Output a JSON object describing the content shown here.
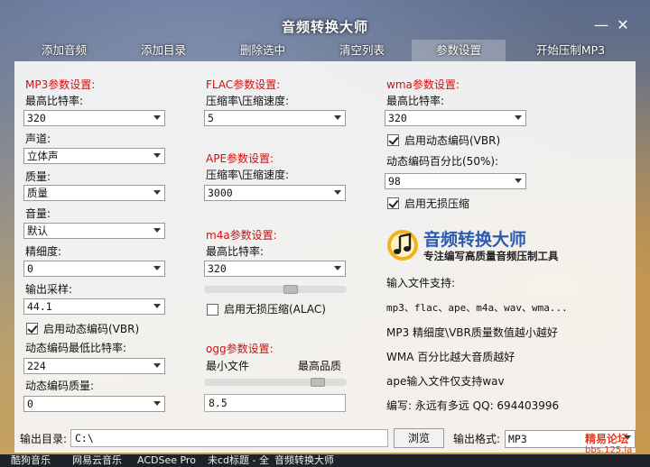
{
  "window": {
    "title": "音频转换大师"
  },
  "toolbar": {
    "add_audio": "添加音频",
    "add_folder": "添加目录",
    "delete_selected": "删除选中",
    "clear_list": "清空列表",
    "settings": "参数设置",
    "start": "开始压制MP3"
  },
  "mp3": {
    "header": "MP3参数设置:",
    "max_bitrate_label": "最高比特率:",
    "max_bitrate": "320",
    "channel_label": "声道:",
    "channel": "立体声",
    "quality_label": "质量:",
    "quality": "质量",
    "volume_label": "音量:",
    "volume": "默认",
    "precision_label": "精细度:",
    "precision": "0",
    "sample_label": "输出采样:",
    "sample": "44.1",
    "vbr_label": "启用动态编码(VBR)",
    "vbr_min_label": "动态编码最低比特率:",
    "vbr_min": "224",
    "vbr_quality_label": "动态编码质量:",
    "vbr_quality": "0"
  },
  "flac": {
    "header": "FLAC参数设置:",
    "rate_label": "压缩率\\压缩速度:",
    "rate": "5"
  },
  "ape": {
    "header": "APE参数设置:",
    "rate_label": "压缩率\\压缩速度:",
    "rate": "3000"
  },
  "m4a": {
    "header": "m4a参数设置:",
    "max_bitrate_label": "最高比特率:",
    "max_bitrate": "320",
    "lossless_label": "启用无损压缩(ALAC)"
  },
  "ogg": {
    "header": "ogg参数设置:",
    "min_label": "最小文件",
    "max_label": "最高品质",
    "value": "8.5"
  },
  "wma": {
    "header": "wma参数设置:",
    "max_bitrate_label": "最高比特率:",
    "max_bitrate": "320",
    "vbr_label": "启用动态编码(VBR)",
    "vbr_pct_label": "动态编码百分比(50%):",
    "vbr_pct": "98",
    "lossless_label": "启用无损压缩"
  },
  "info": {
    "brand_name": "音频转换大师",
    "brand_sub": "专注编写高质量音频压制工具",
    "input_title": "输入文件支持:",
    "formats": "mp3、flac、ape、m4a、wav、wma...",
    "line1": "MP3 精细度\\VBR质量数值越小越好",
    "line2": "WMA 百分比越大音质越好",
    "line3": "ape输入文件仅支持wav",
    "author": "编写: 永远有多远 QQ: 694403996"
  },
  "output": {
    "dir_label": "输出目录:",
    "dir": "C:\\",
    "browse": "浏览",
    "format_label": "输出格式:",
    "format": "MP3"
  },
  "watermark": {
    "name": "精易论坛",
    "url": "bbs.125.la"
  },
  "taskbar": [
    "酷狗音乐",
    "网易云音乐",
    "ACDSee Pro",
    "未cd标题 - 全",
    "音频转换大师"
  ]
}
